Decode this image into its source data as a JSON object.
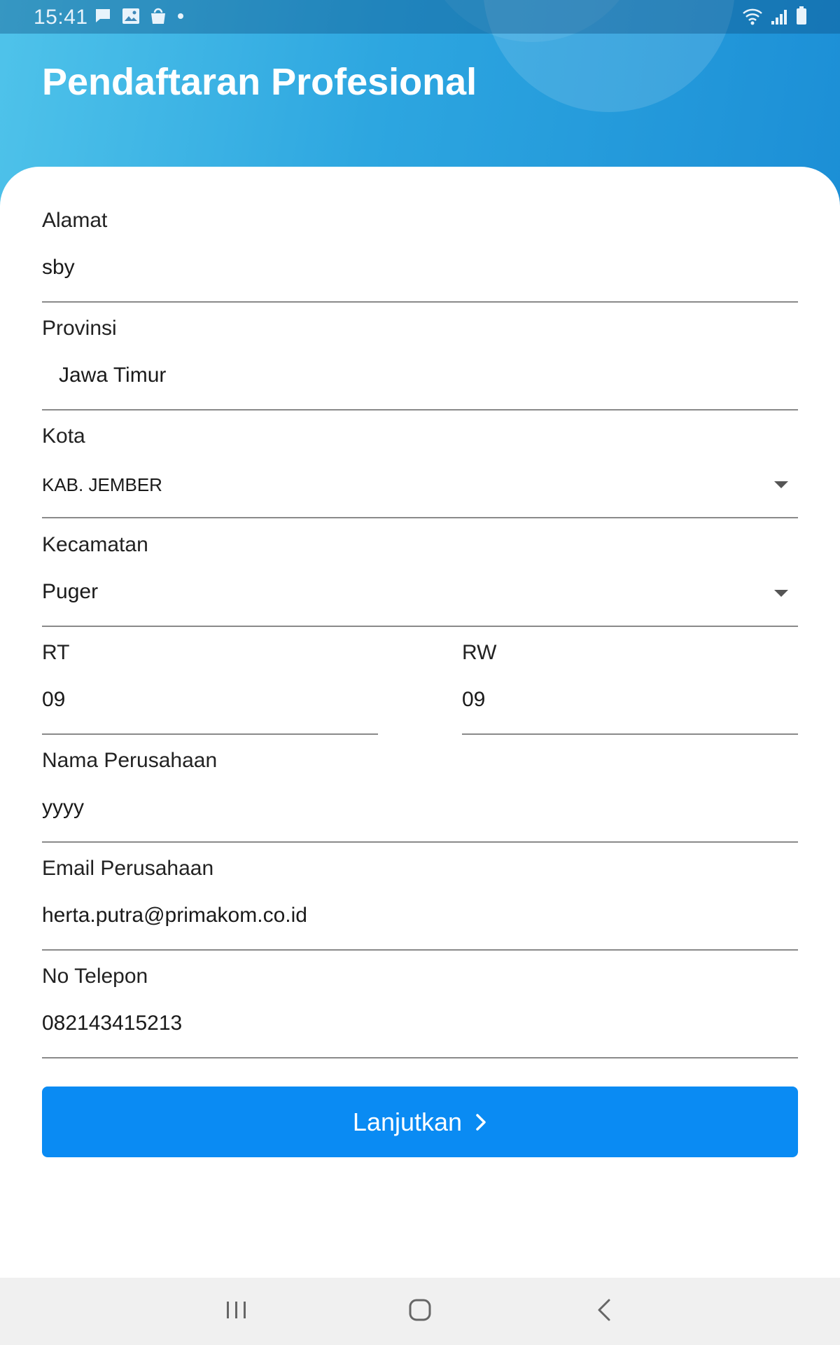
{
  "status_bar": {
    "time": "15:41"
  },
  "header": {
    "title": "Pendaftaran Profesional"
  },
  "form": {
    "alamat": {
      "label": "Alamat",
      "value": "sby"
    },
    "provinsi": {
      "label": "Provinsi",
      "value": "Jawa Timur"
    },
    "kota": {
      "label": "Kota",
      "value": "KAB. JEMBER"
    },
    "kecamatan": {
      "label": "Kecamatan",
      "value": "Puger"
    },
    "rt": {
      "label": "RT",
      "value": "09"
    },
    "rw": {
      "label": "RW",
      "value": "09"
    },
    "nama_perusahaan": {
      "label": "Nama Perusahaan",
      "value": "yyyy"
    },
    "email_perusahaan": {
      "label": "Email Perusahaan",
      "value": "herta.putra@primakom.co.id"
    },
    "no_telepon": {
      "label": "No Telepon",
      "value": "082143415213"
    }
  },
  "submit": {
    "label": "Lanjutkan"
  },
  "colors": {
    "header_gradient_start": "#4fc3ea",
    "header_gradient_end": "#1c8fd6",
    "button": "#0a8bf3"
  },
  "icons": {
    "status_left": [
      "message-icon",
      "image-icon",
      "shopping-bag-icon",
      "dot-icon"
    ],
    "status_right": [
      "wifi-icon",
      "signal-icon",
      "battery-icon"
    ],
    "nav": [
      "recents-icon",
      "home-icon",
      "back-icon"
    ]
  }
}
